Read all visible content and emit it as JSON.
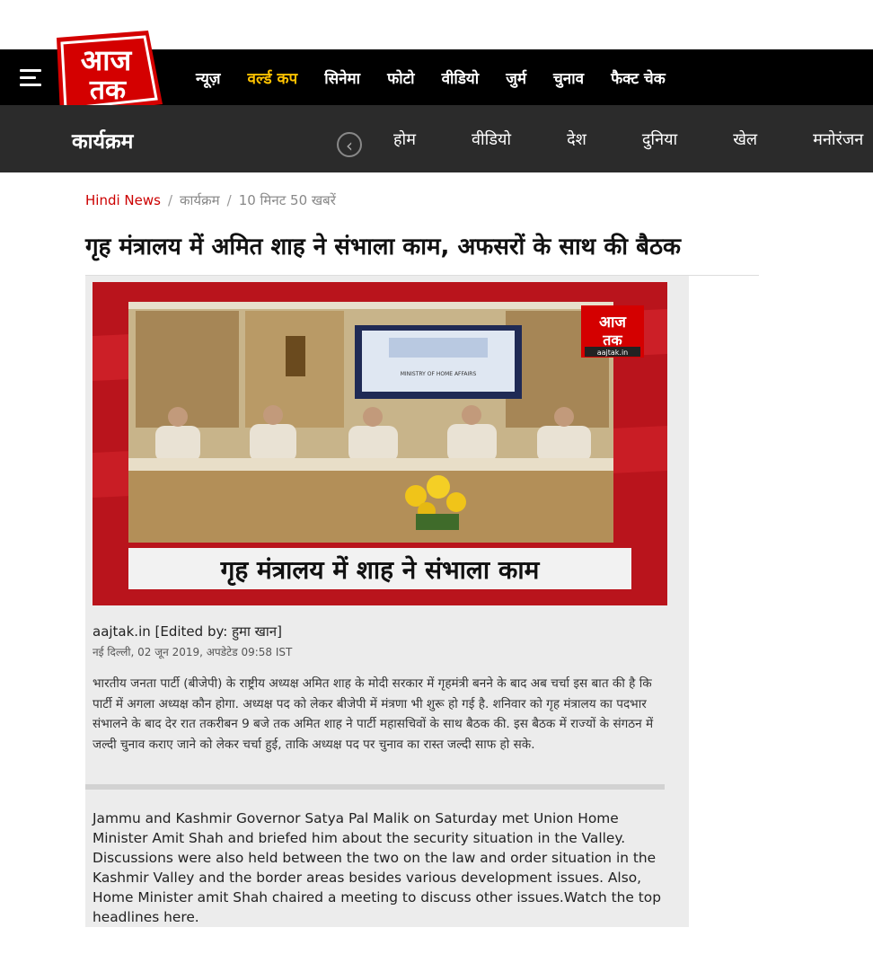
{
  "header": {
    "logo_text_top": "आज",
    "logo_text_bottom": "तक",
    "nav": [
      "न्यूज़",
      "वर्ल्ड कप",
      "सिनेमा",
      "फोटो",
      "वीडियो",
      "जुर्म",
      "चुनाव",
      "फैक्ट चेक"
    ],
    "active_nav": "वर्ल्ड कप",
    "accent_color": "#ffc200",
    "brand_red": "#d40000"
  },
  "subheader": {
    "section_title": "कार्यक्रम",
    "prev_icon": "chevron-left-icon",
    "nav": [
      "होम",
      "वीडियो",
      "देश",
      "दुनिया",
      "खेल",
      "मनोरंजन"
    ]
  },
  "breadcrumb": {
    "home": "Hindi News",
    "section": "कार्यक्रम",
    "current": "10 मिनट 50 खबरें",
    "separator": "/"
  },
  "article": {
    "headline": "गृह मंत्रालय में अमित शाह ने संभाला काम, अफसरों के साथ की बैठक",
    "video": {
      "caption": "गृह मंत्रालय में शाह ने संभाला काम",
      "screen_text": "MINISTRY OF HOME AFFAIRS",
      "watermark_top": "आज",
      "watermark_bottom": "तक",
      "watermark_site": "aajtak.in"
    },
    "byline": "aajtak.in [Edited by: हुमा खान]",
    "dateline": "नई दिल्ली, 02 जून 2019, अपडेटेड 09:58 IST",
    "summary": "भारतीय जनता पार्टी (बीजेपी) के राष्ट्रीय अध्यक्ष अमित शाह के मोदी सरकार में गृहमंत्री बनने के बाद अब चर्चा इस बात की है कि पार्टी में अगला अध्यक्ष कौन होगा. अध्यक्ष पद को लेकर बीजेपी में मंत्रणा भी शुरू हो गई है. शनिवार को गृह मंत्रालय का पदभार संभालने के बाद देर रात तकरीबन 9 बजे तक अमित शाह ने पार्टी महासचिवों के साथ बैठक की. इस बैठक में राज्यों के संगठन में जल्दी चुनाव कराए जाने को लेकर चर्चा हुई, ताकि अध्यक्ष पद पर चुनाव का रास्त जल्दी साफ हो सके.",
    "english": "Jammu and Kashmir Governor Satya Pal Malik on Saturday met Union Home Minister Amit Shah and briefed him about the security situation in the Valley. Discussions were also held between the two on the law and order situation in the Kashmir Valley and the border areas besides various development issues. Also, Home Minister amit Shah chaired a meeting to discuss other issues.Watch the top headlines here."
  }
}
